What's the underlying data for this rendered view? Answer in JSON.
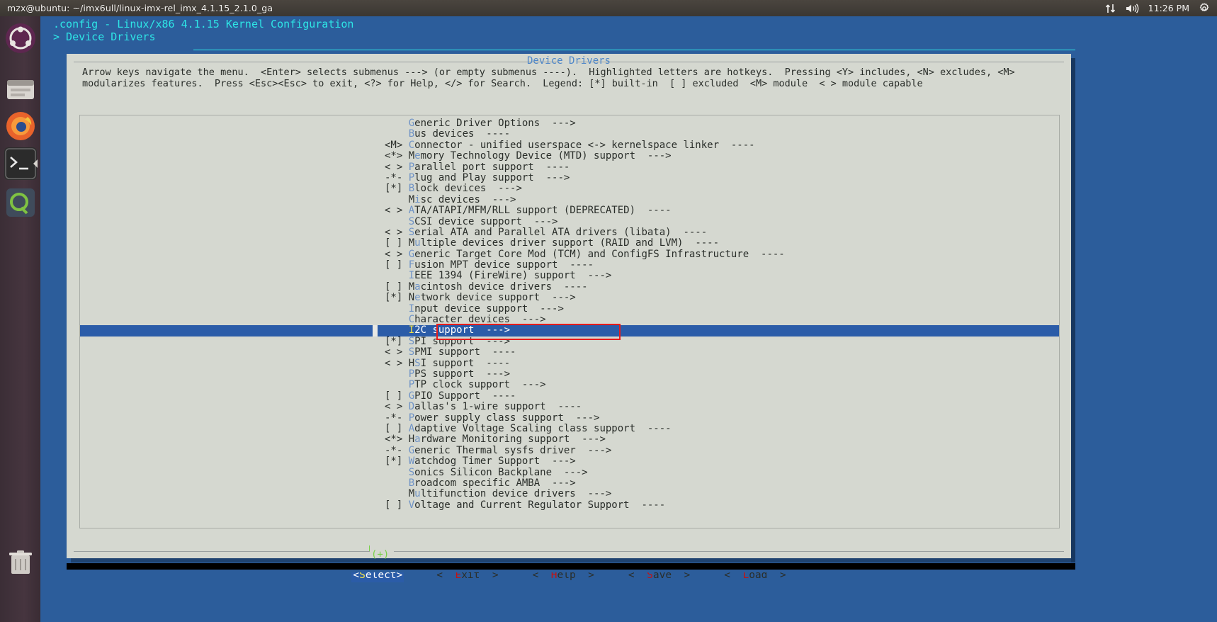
{
  "topbar": {
    "window_title": "mzx@ubuntu: ~/imx6ull/linux-imx-rel_imx_4.1.15_2.1.0_ga",
    "clock": "11:26 PM",
    "icons": [
      "network-updown-icon",
      "volume-icon",
      "gear-icon"
    ]
  },
  "launcher": {
    "items": [
      {
        "name": "ubuntu-dash-icon"
      },
      {
        "name": "files-icon"
      },
      {
        "name": "firefox-icon"
      },
      {
        "name": "terminal-icon"
      },
      {
        "name": "qt-creator-icon"
      },
      {
        "name": "trash-icon"
      }
    ]
  },
  "menuconfig": {
    "header_title": ".config - Linux/x86 4.1.15 Kernel Configuration",
    "breadcrumb": "> Device Drivers",
    "dialog_title": "Device Drivers",
    "instructions": "Arrow keys navigate the menu.  <Enter> selects submenus ---> (or empty submenus ----).  Highlighted letters are hotkeys.  Pressing <Y> includes, <N> excludes, <M>\nmodularizes features.  Press <Esc><Esc> to exit, <?> for Help, </> for Search.  Legend: [*] built-in  [ ] excluded  <M> module  < > module capable",
    "scroll_indicator": "(+)",
    "selected_index": 19,
    "items": [
      {
        "prefix": "   ",
        "hotkey": "G",
        "pre": "",
        "post": "eneric Driver Options",
        "arrow": "--->"
      },
      {
        "prefix": "   ",
        "hotkey": "B",
        "pre": "",
        "post": "us devices",
        "arrow": "----"
      },
      {
        "prefix": "<M>",
        "hotkey": "C",
        "pre": "",
        "post": "onnector - unified userspace <-> kernelspace linker",
        "arrow": "----"
      },
      {
        "prefix": "<*>",
        "hotkey": "e",
        "pre": "M",
        "post": "mory Technology Device (MTD) support",
        "arrow": "--->"
      },
      {
        "prefix": "< >",
        "hotkey": "P",
        "pre": "",
        "post": "arallel port support",
        "arrow": "----"
      },
      {
        "prefix": "-*-",
        "hotkey": "P",
        "pre": "",
        "post": "lug and Play support",
        "arrow": "--->"
      },
      {
        "prefix": "[*]",
        "hotkey": "B",
        "pre": "",
        "post": "lock devices",
        "arrow": "--->"
      },
      {
        "prefix": "   ",
        "hotkey": "i",
        "pre": "M",
        "post": "sc devices",
        "arrow": "--->"
      },
      {
        "prefix": "< >",
        "hotkey": "A",
        "pre": "",
        "post": "TA/ATAPI/MFM/RLL support (DEPRECATED)",
        "arrow": "----"
      },
      {
        "prefix": "   ",
        "hotkey": "S",
        "pre": "",
        "post": "CSI device support",
        "arrow": "--->"
      },
      {
        "prefix": "< >",
        "hotkey": "S",
        "pre": "",
        "post": "erial ATA and Parallel ATA drivers (libata)",
        "arrow": "----"
      },
      {
        "prefix": "[ ]",
        "hotkey": "u",
        "pre": "M",
        "post": "ltiple devices driver support (RAID and LVM)",
        "arrow": "----"
      },
      {
        "prefix": "< >",
        "hotkey": "G",
        "pre": "",
        "post": "eneric Target Core Mod (TCM) and ConfigFS Infrastructure",
        "arrow": "----"
      },
      {
        "prefix": "[ ]",
        "hotkey": "F",
        "pre": "",
        "post": "usion MPT device support",
        "arrow": "----"
      },
      {
        "prefix": "   ",
        "hotkey": "I",
        "pre": "",
        "post": "EEE 1394 (FireWire) support",
        "arrow": "--->"
      },
      {
        "prefix": "[ ]",
        "hotkey": "a",
        "pre": "M",
        "post": "cintosh device drivers",
        "arrow": "----"
      },
      {
        "prefix": "[*]",
        "hotkey": "e",
        "pre": "N",
        "post": "twork device support",
        "arrow": "--->"
      },
      {
        "prefix": "   ",
        "hotkey": "I",
        "pre": "",
        "post": "nput device support",
        "arrow": "--->"
      },
      {
        "prefix": "   ",
        "hotkey": "C",
        "pre": "",
        "post": "haracter devices",
        "arrow": "--->"
      },
      {
        "prefix": "   ",
        "hotkey": "I",
        "pre": "",
        "post": "2C support",
        "arrow": "--->"
      },
      {
        "prefix": "[*]",
        "hotkey": "S",
        "pre": "",
        "post": "PI support",
        "arrow": "--->"
      },
      {
        "prefix": "< >",
        "hotkey": "S",
        "pre": "",
        "post": "PMI support",
        "arrow": "----"
      },
      {
        "prefix": "< >",
        "hotkey": "S",
        "pre": "H",
        "post": "I support",
        "arrow": "----"
      },
      {
        "prefix": "   ",
        "hotkey": "P",
        "pre": "",
        "post": "PS support",
        "arrow": "--->"
      },
      {
        "prefix": "   ",
        "hotkey": "P",
        "pre": "",
        "post": "TP clock support",
        "arrow": "--->"
      },
      {
        "prefix": "[ ]",
        "hotkey": "G",
        "pre": "",
        "post": "PIO Support",
        "arrow": "----"
      },
      {
        "prefix": "< >",
        "hotkey": "D",
        "pre": "",
        "post": "allas's 1-wire support",
        "arrow": "----"
      },
      {
        "prefix": "-*-",
        "hotkey": "P",
        "pre": "",
        "post": "ower supply class support",
        "arrow": "--->"
      },
      {
        "prefix": "[ ]",
        "hotkey": "A",
        "pre": "",
        "post": "daptive Voltage Scaling class support",
        "arrow": "----"
      },
      {
        "prefix": "<*>",
        "hotkey": "a",
        "pre": "H",
        "post": "rdware Monitoring support",
        "arrow": "--->"
      },
      {
        "prefix": "-*-",
        "hotkey": "G",
        "pre": "",
        "post": "eneric Thermal sysfs driver",
        "arrow": "--->"
      },
      {
        "prefix": "[*]",
        "hotkey": "W",
        "pre": "",
        "post": "atchdog Timer Support",
        "arrow": "--->"
      },
      {
        "prefix": "   ",
        "hotkey": "S",
        "pre": "",
        "post": "onics Silicon Backplane",
        "arrow": "--->"
      },
      {
        "prefix": "   ",
        "hotkey": "B",
        "pre": "",
        "post": "roadcom specific AMBA",
        "arrow": "--->"
      },
      {
        "prefix": "   ",
        "hotkey": "u",
        "pre": "M",
        "post": "ltifunction device drivers",
        "arrow": "--->"
      },
      {
        "prefix": "[ ]",
        "hotkey": "V",
        "pre": "",
        "post": "oltage and Current Regulator Support",
        "arrow": "----"
      }
    ],
    "buttons": [
      {
        "name": "select-button",
        "left": "<",
        "hotkey": "S",
        "pre": "",
        "post": "elect",
        "right": ">",
        "selected": true
      },
      {
        "name": "exit-button",
        "left": "<  ",
        "hotkey": "E",
        "pre": "",
        "post": "xit",
        "right": "  >",
        "selected": false
      },
      {
        "name": "help-button",
        "left": "<  ",
        "hotkey": "H",
        "pre": "",
        "post": "elp",
        "right": "  >",
        "selected": false
      },
      {
        "name": "save-button",
        "left": "<  ",
        "hotkey": "S",
        "pre": "",
        "post": "ave",
        "right": "  >",
        "selected": false
      },
      {
        "name": "load-button",
        "left": "<  ",
        "hotkey": "L",
        "pre": "",
        "post": "oad",
        "right": "  >",
        "selected": false
      }
    ]
  },
  "colors": {
    "accent_blue": "#2b5ca8",
    "hotkey_blue": "#6f93c6",
    "hotkey_yellow": "#f2e14a",
    "hotkey_red": "#c31212",
    "cyan_header": "#2ee6e6",
    "dialog_bg": "#d5d8d0",
    "annotation_red": "#e61b1b",
    "scroll_green": "#79d14a"
  }
}
